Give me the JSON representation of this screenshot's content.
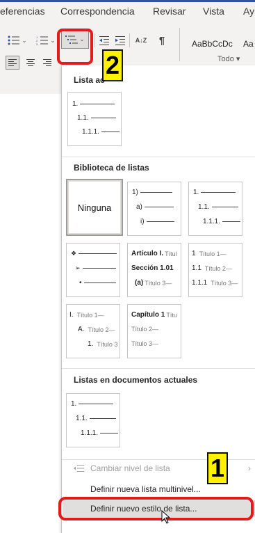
{
  "ribbon": {
    "tabs": [
      "eferencias",
      "Correspondencia",
      "Revisar",
      "Vista",
      "Ay"
    ],
    "sort_label": "A↓Z",
    "pilcrow": "¶",
    "style_preview_1": "AaBbCcDc",
    "style_preview_2": "Aa",
    "todo_label": "Todo ▾"
  },
  "annotations": {
    "badge_1": "1",
    "badge_2": "2"
  },
  "panel": {
    "current_list_title": "Lista actual",
    "current_list_visible": "Lista ac",
    "current_list": [
      "1.",
      "1.1.",
      "1.1.1."
    ],
    "library_title": "Biblioteca de listas",
    "library": {
      "none": "Ninguna",
      "item2": [
        "1)",
        "a)",
        "i)"
      ],
      "item3": [
        "1.",
        "1.1.",
        "1.1.1."
      ],
      "item4_bullets": [
        "❖",
        "➢",
        "•"
      ],
      "item5": [
        {
          "main": "Artículo I.",
          "gray": "Títul"
        },
        {
          "main": "Sección 1.01",
          "gray": ""
        },
        {
          "main": "(a)",
          "gray": "Título 3—"
        }
      ],
      "item6": [
        {
          "main": "1",
          "gray": "Título 1—"
        },
        {
          "main": "1.1",
          "gray": "Título 2—"
        },
        {
          "main": "1.1.1",
          "gray": "Título 3—"
        }
      ],
      "item7": [
        {
          "main": "I.",
          "gray": "Título 1—"
        },
        {
          "main": "A.",
          "gray": "Título 2—"
        },
        {
          "main": "1.",
          "gray": "Título 3"
        }
      ],
      "item8": [
        {
          "main": "Capítulo 1",
          "gray": "Títu"
        },
        {
          "main": "",
          "gray": "Título 2—"
        },
        {
          "main": "",
          "gray": "Título 3—"
        }
      ]
    },
    "documents_title": "Listas en documentos actuales",
    "documents_list": [
      "1.",
      "1.1.",
      "1.1.1."
    ],
    "menu": {
      "change_level": "Cambiar nivel de lista",
      "define_multilevel": "Definir nueva lista multinivel...",
      "define_style": "Definir nuevo estilo de lista..."
    }
  },
  "colors": {
    "highlight": "#e21b1b",
    "badge": "#fff200",
    "ribbon_bg": "#f3f2f1",
    "accent": "#2b579a"
  }
}
